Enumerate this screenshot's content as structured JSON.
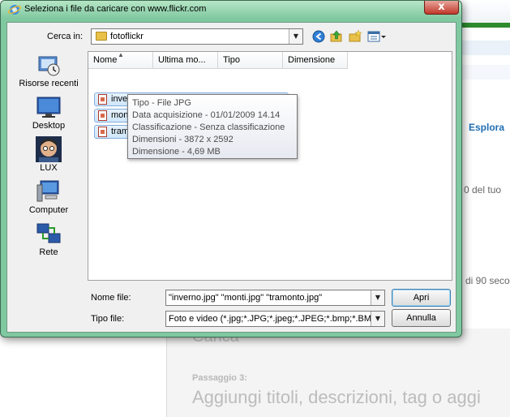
{
  "background": {
    "explore_link": "Esplora",
    "text_fragment_1": "0 del tuo",
    "text_fragment_2": "di 90 seco",
    "upload_heading": "Carica",
    "step_label": "Passaggio 3:",
    "step_title": "Aggiungi titoli, descrizioni, tag o aggi"
  },
  "dialog": {
    "title": "Seleziona i file da caricare con www.flickr.com",
    "close_label": "x",
    "look_in_label": "Cerca in:",
    "look_in_value": "fotoflickr",
    "toolbar_icons": [
      "back-icon",
      "up-folder-icon",
      "new-folder-icon",
      "view-menu-icon"
    ],
    "places": [
      {
        "name": "recent-places",
        "label": "Risorse recenti"
      },
      {
        "name": "desktop",
        "label": "Desktop"
      },
      {
        "name": "user",
        "label": "LUX"
      },
      {
        "name": "computer",
        "label": "Computer"
      },
      {
        "name": "network",
        "label": "Rete"
      }
    ],
    "columns": [
      "Nome",
      "Ultima mo...",
      "Tipo",
      "Dimensione"
    ],
    "files": [
      {
        "name": "inverno"
      },
      {
        "name": "monti"
      },
      {
        "name": "tramonto"
      }
    ],
    "tooltip": {
      "type": "Tipo - File JPG",
      "date": "Data acquisizione - 01/01/2009 14.14",
      "rating": "Classificazione - Senza classificazione",
      "dimensions": "Dimensioni - 3872 x 2592",
      "size": "Dimensione - 4,69 MB"
    },
    "filename_label": "Nome file:",
    "filename_value": "\"inverno.jpg\" \"monti.jpg\" \"tramonto.jpg\"",
    "filetype_label": "Tipo file:",
    "filetype_value": "Foto e video (*.jpg;*.JPG;*.jpeg;*.JPEG;*.bmp;*.BMP;",
    "open_button": "Apri",
    "cancel_button": "Annulla"
  }
}
